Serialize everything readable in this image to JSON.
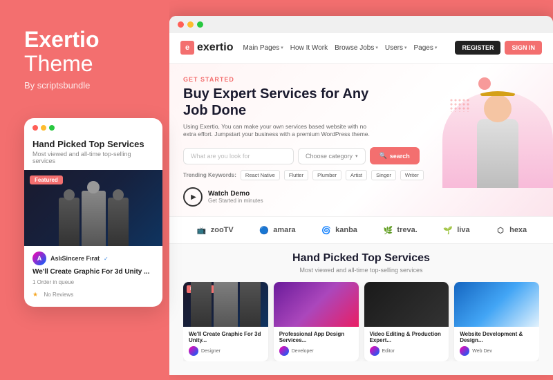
{
  "brand": {
    "name": "Exertio",
    "theme": "Theme",
    "by": "By scriptsbundle"
  },
  "mobile_card": {
    "title": "Hand Picked Top Services",
    "subtitle": "Most viewed and all-time top-selling services",
    "featured_badge": "Featured",
    "service_title": "We'll Create Graphic For 3d Unity ...",
    "user_name": "AslıSincere Fırat",
    "orders": "1 Order in queue",
    "reviews": "No Reviews"
  },
  "navbar": {
    "logo": "exertio",
    "links": [
      {
        "label": "Main Pages",
        "has_chevron": true
      },
      {
        "label": "How It Work",
        "has_chevron": false
      },
      {
        "label": "Browse Jobs",
        "has_chevron": true
      },
      {
        "label": "Users",
        "has_chevron": true
      },
      {
        "label": "Pages",
        "has_chevron": true
      }
    ],
    "register_label": "REGISTER",
    "signin_label": "SIGN IN"
  },
  "hero": {
    "tag": "GET STARTED",
    "title": "Buy Expert Services for Any Job Done",
    "description": "Using Exertio, You can make your own services based website with no extra effort. Jumpstart your business with a premium WordPress theme.",
    "search_placeholder": "What are you look for",
    "category_placeholder": "Choose category",
    "search_btn": "search",
    "trending_label": "Trending Keywords:",
    "trending_tags": [
      "React Native",
      "Flutter",
      "Plumber",
      "Artist",
      "Singer",
      "Writer"
    ],
    "watch_demo_label": "Watch Demo",
    "watch_demo_sub": "Get Started in minutes"
  },
  "logos": [
    {
      "name": "zooTV",
      "icon": "📺"
    },
    {
      "name": "amara",
      "icon": "🔵"
    },
    {
      "name": "kanba",
      "icon": "🌀"
    },
    {
      "name": "treva.",
      "icon": "🌿"
    },
    {
      "name": "liva",
      "icon": "🌱"
    },
    {
      "name": "hexa",
      "icon": "⬡"
    }
  ],
  "bottom_section": {
    "title": "Hand Picked Top Services",
    "subtitle": "Most viewed and all-time top-selling services",
    "featured_badge": "Featured",
    "cards": [
      {
        "title": "We'll Create Graphic For 3d Unity...",
        "style": "dark",
        "featured": true
      },
      {
        "title": "Professional App Design Services...",
        "style": "purple",
        "featured": false
      },
      {
        "title": "Video Editing & Production Expert...",
        "style": "black",
        "featured": false
      },
      {
        "title": "Website Development & Design...",
        "style": "blue",
        "featured": false
      }
    ]
  }
}
